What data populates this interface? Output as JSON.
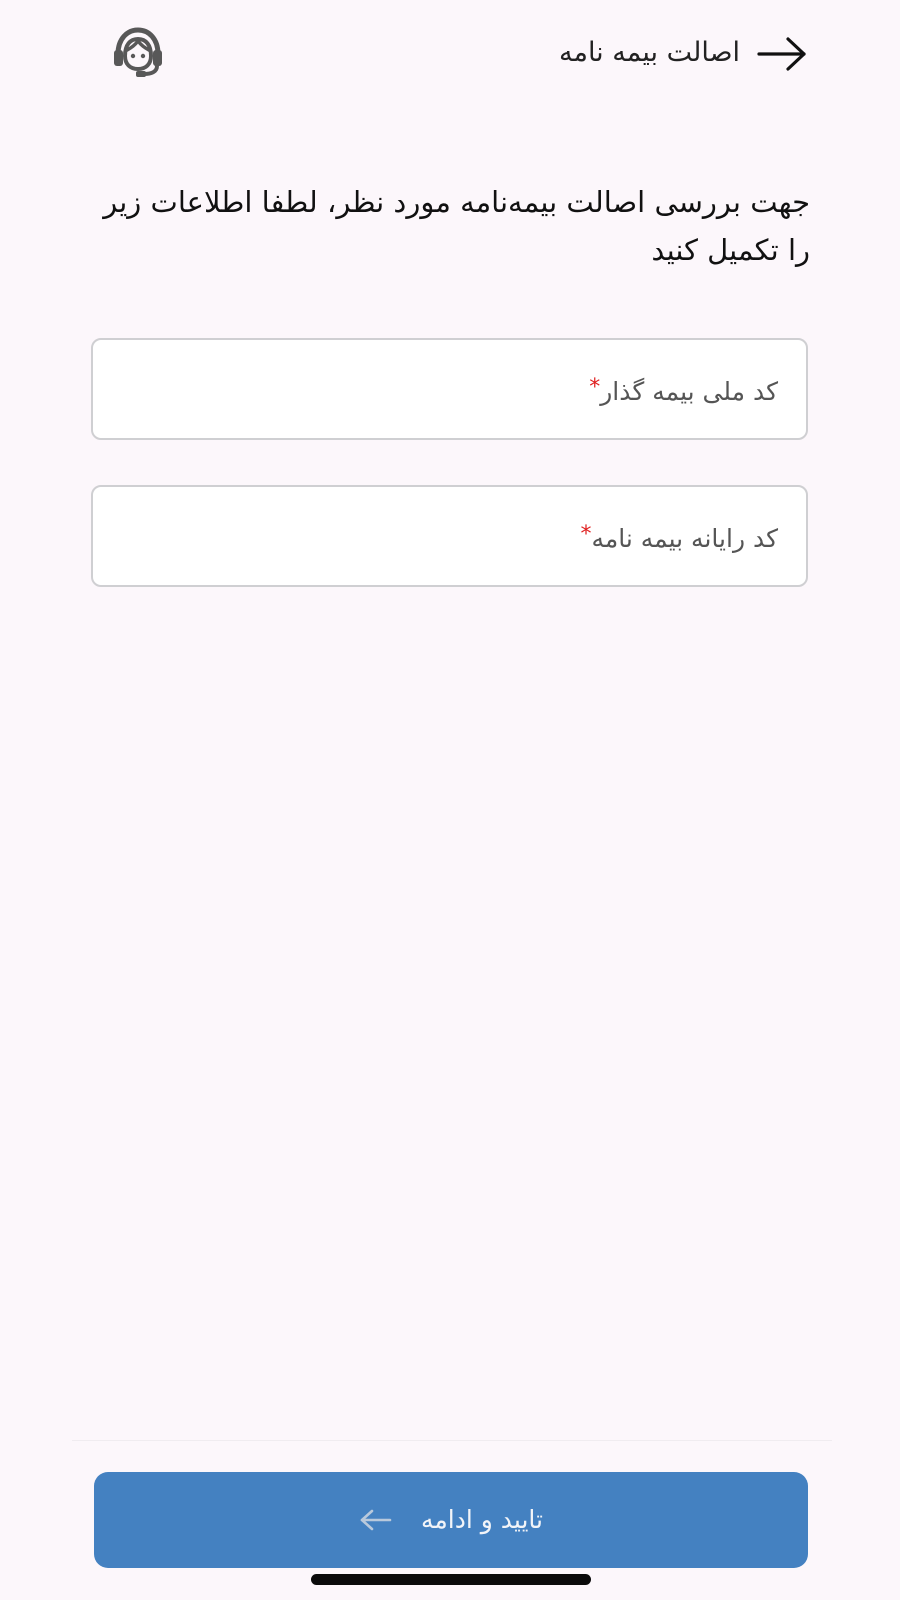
{
  "header": {
    "title": "اصالت بیمه نامه",
    "back_icon": "arrow-right-icon",
    "support_icon": "headset-support-icon"
  },
  "instruction": {
    "text": "جهت بررسی اصالت بیمه‌نامه مورد نظر، لطفا اطلاعات زیر را تکمیل کنید"
  },
  "form": {
    "fields": [
      {
        "label": "کد ملی بیمه گذار",
        "required_mark": "*",
        "value": ""
      },
      {
        "label": "کد رایانه بیمه نامه",
        "required_mark": "*",
        "value": ""
      }
    ]
  },
  "footer": {
    "continue_label": "تایید و ادامه",
    "continue_icon": "arrow-left-icon"
  },
  "colors": {
    "background": "#fcf7fb",
    "primary_button": "#4481c1",
    "required": "#e02020",
    "field_border": "#cfcfd2"
  }
}
